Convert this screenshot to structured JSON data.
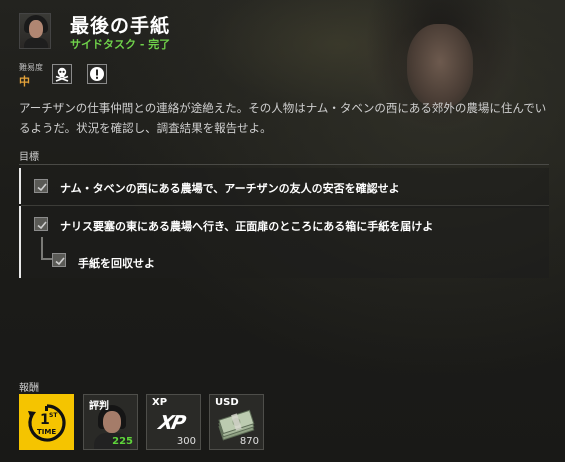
{
  "header": {
    "title": "最後の手紙",
    "subtitle": "サイドタスク - 完了",
    "avatar_icon": "character-portrait"
  },
  "difficulty": {
    "label": "難易度",
    "value": "中",
    "value_color": "#e3a23a",
    "badges": [
      "skull-crossbones-icon",
      "exclamation-icon"
    ]
  },
  "description": "アーチザンの仕事仲間との連絡が途絶えた。その人物はナム・タベンの西にある郊外の農場に住んでいるようだ。状況を確認し、調査結果を報告せよ。",
  "objectives": {
    "label": "目標",
    "items": [
      {
        "text": "ナム・タベンの西にある農場で、アーチザンの友人の安否を確認せよ",
        "completed": true
      },
      {
        "text": "ナリス要塞の東にある農場へ行き、正面扉のところにある箱に手紙を届けよ",
        "completed": true
      },
      {
        "text": "手紙を回収せよ",
        "completed": true,
        "sub": true
      }
    ]
  },
  "rewards": {
    "label": "報酬",
    "items": [
      {
        "type": "first-time",
        "icon": "first-time-icon",
        "badge_text_top": "1",
        "badge_text_sup": "ST",
        "badge_text_bottom": "TIME"
      },
      {
        "type": "reputation",
        "label": "評判",
        "value": "225",
        "icon": "character-portrait"
      },
      {
        "type": "xp",
        "label": "XP",
        "value": "300",
        "icon": "xp-icon",
        "icon_text": "XP"
      },
      {
        "type": "usd",
        "label": "USD",
        "value": "870",
        "icon": "cash-stack-icon"
      }
    ]
  },
  "colors": {
    "accent_green": "#6fd14a",
    "first_time_yellow": "#f5c400",
    "reputation_value": "#5ed43a"
  }
}
